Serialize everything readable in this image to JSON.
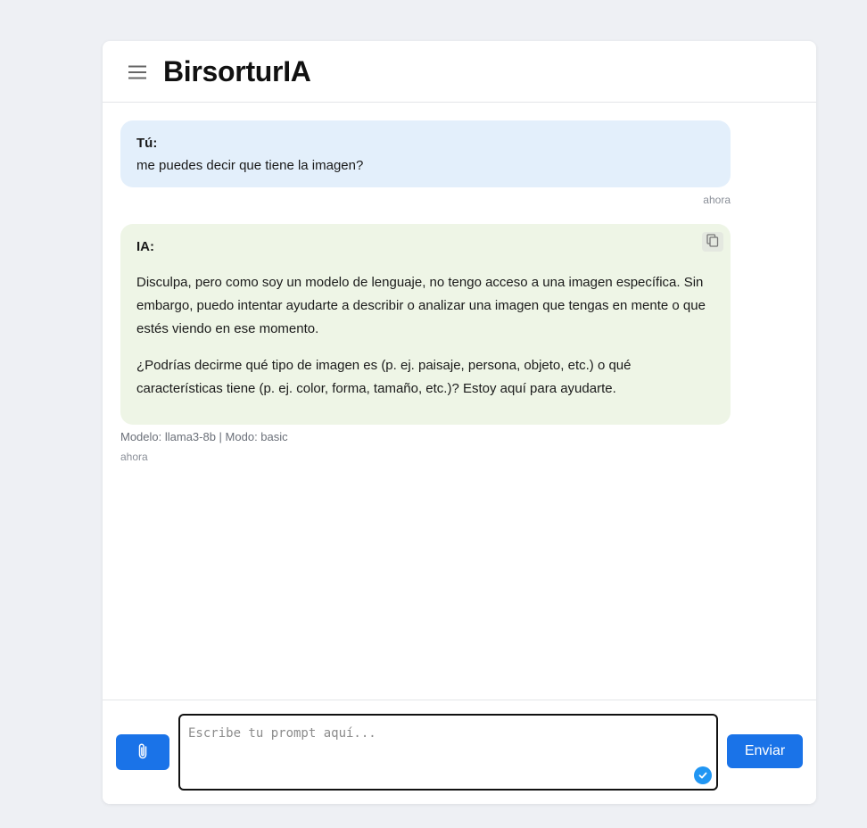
{
  "app": {
    "title": "BirsorturIA"
  },
  "icons": {
    "menu": "hamburger-icon",
    "copy": "copy-icon",
    "attach": "paperclip-icon",
    "check": "check-circle-icon"
  },
  "colors": {
    "accent": "#1a73e8",
    "user_bubble": "#e3effb",
    "ai_bubble": "#eef5e6",
    "check": "#2196f3"
  },
  "messages": [
    {
      "sender": "Tú:",
      "text": "me puedes decir que tiene la imagen?",
      "time": "ahora"
    },
    {
      "sender": "IA:",
      "paragraphs": [
        "Disculpa, pero como soy un modelo de lenguaje, no tengo acceso a una imagen específica. Sin embargo, puedo intentar ayudarte a describir o analizar una imagen que tengas en mente o que estés viendo en ese momento.",
        "¿Podrías decirme qué tipo de imagen es (p. ej. paisaje, persona, objeto, etc.) o qué características tiene (p. ej. color, forma, tamaño, etc.)? Estoy aquí para ayudarte."
      ],
      "meta": "Modelo: llama3-8b | Modo: basic",
      "time": "ahora"
    }
  ],
  "composer": {
    "placeholder": "Escribe tu prompt aquí...",
    "value": "",
    "send_label": "Enviar"
  }
}
